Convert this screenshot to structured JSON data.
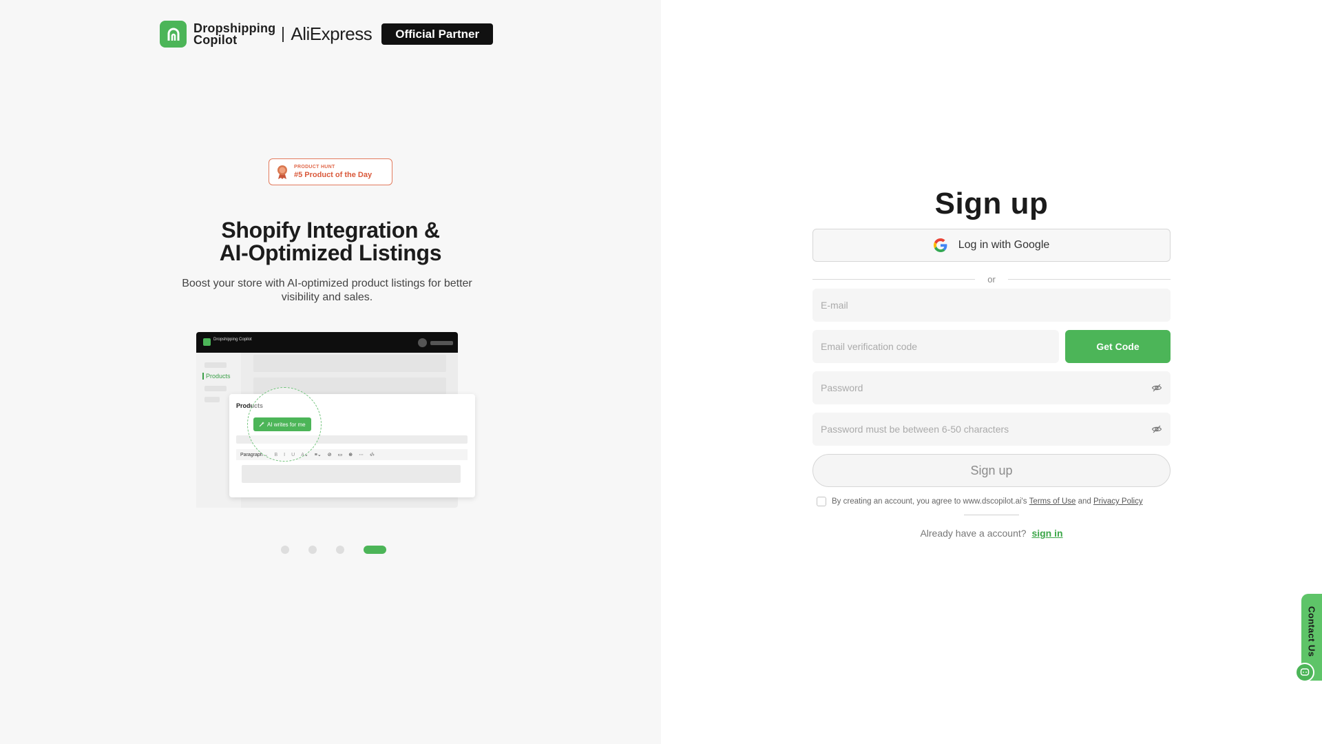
{
  "brand": {
    "name_line1": "Dropshipping",
    "name_line2": "Copilot",
    "partner_name": "AliExpress",
    "partner_badge": "Official Partner"
  },
  "badge": {
    "small": "PRODUCT HUNT",
    "big": "#5 Product of the Day"
  },
  "hero": {
    "title_line1": "Shopify Integration &",
    "title_line2": "AI-Optimized Listings",
    "subtitle": "Boost your store with AI-optimized product listings for better visibility and sales."
  },
  "illustration": {
    "brand": "Dropshipping Copilot",
    "sidebar_item": "Products",
    "card_title": "Products",
    "ai_button": "AI writes for me",
    "toolbar": [
      "Paragraph ⌄",
      "B",
      "I",
      "U",
      "A⌄",
      "≡⌄",
      "⊘",
      "▭",
      "⊕",
      "⋯",
      "‹/›"
    ]
  },
  "carousel": {
    "count": 4,
    "active_index": 3
  },
  "form": {
    "title": "Sign up",
    "google_label": "Log in with Google",
    "or_label": "or",
    "email_placeholder": "E-mail",
    "code_placeholder": "Email verification code",
    "get_code_label": "Get Code",
    "password_placeholder": "Password",
    "confirm_placeholder": "Password must be between 6-50 characters",
    "signup_label": "Sign up",
    "terms_prefix": "By creating an account, you agree to www.dscopilot.ai's",
    "terms_link": "Terms of Use",
    "terms_and": "and",
    "privacy_link": "Privacy Policy",
    "already_text": "Already have a account?",
    "signin_link": "sign in"
  },
  "contact": {
    "label": "Contact Us"
  },
  "colors": {
    "accent": "#4cb558",
    "badge_orange": "#e27a5c",
    "dark": "#111111"
  },
  "icons": [
    "app-logo-icon",
    "medal-icon",
    "google-icon",
    "eye-off-icon",
    "chat-icon",
    "magic-wand-icon"
  ]
}
